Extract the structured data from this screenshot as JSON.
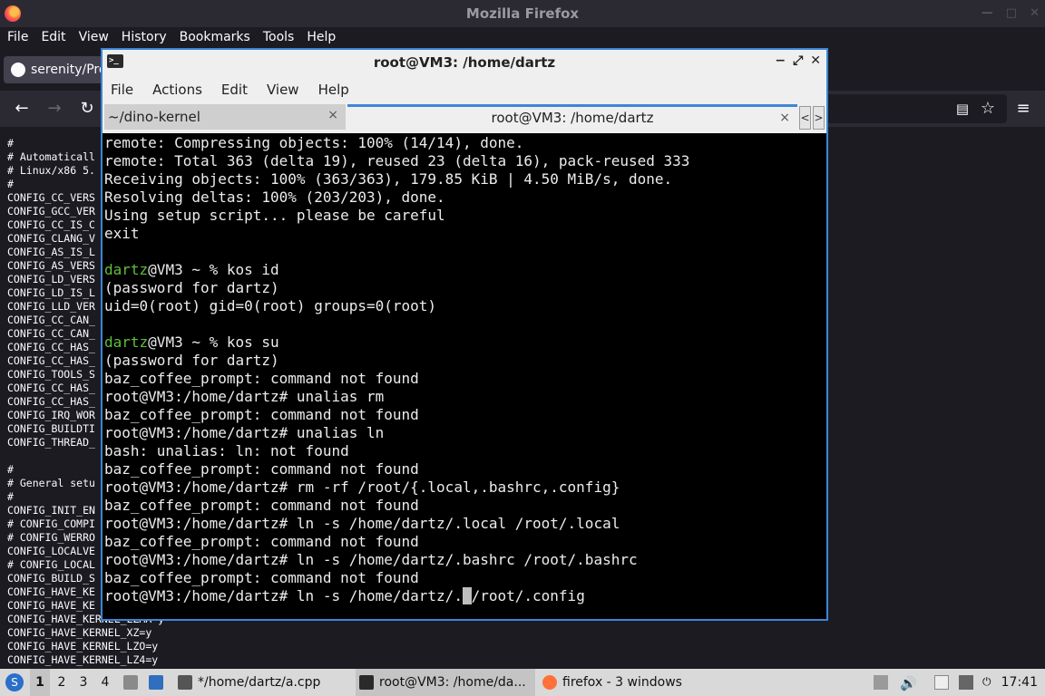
{
  "firefox": {
    "title": "Mozilla Firefox",
    "menu": [
      "File",
      "Edit",
      "View",
      "History",
      "Bookmarks",
      "Tools",
      "Help"
    ],
    "menu_underline": [
      "F",
      "E",
      "V",
      "H",
      "B",
      "T",
      "H"
    ],
    "tab_label": "serenity/Pro",
    "config_lines": [
      "#",
      "# Automaticall",
      "# Linux/x86 5.",
      "#",
      "CONFIG_CC_VERS",
      "CONFIG_GCC_VER",
      "CONFIG_CC_IS_C",
      "CONFIG_CLANG_V",
      "CONFIG_AS_IS_L",
      "CONFIG_AS_VERS",
      "CONFIG_LD_VERS",
      "CONFIG_LD_IS_L",
      "CONFIG_LLD_VER",
      "CONFIG_CC_CAN_",
      "CONFIG_CC_CAN_",
      "CONFIG_CC_HAS_",
      "CONFIG_CC_HAS_",
      "CONFIG_TOOLS_S",
      "CONFIG_CC_HAS_",
      "CONFIG_CC_HAS_",
      "CONFIG_IRQ_WOR",
      "CONFIG_BUILDTI",
      "CONFIG_THREAD_",
      "",
      "#",
      "# General setu",
      "#",
      "CONFIG_INIT_EN",
      "# CONFIG_COMPI",
      "# CONFIG_WERRO",
      "CONFIG_LOCALVE",
      "# CONFIG_LOCAL",
      "CONFIG_BUILD_S",
      "CONFIG_HAVE_KE",
      "CONFIG_HAVE_KE",
      "CONFIG_HAVE_KERNEL_LZMA=y",
      "CONFIG_HAVE_KERNEL_XZ=y",
      "CONFIG_HAVE_KERNEL_LZO=y",
      "CONFIG_HAVE_KERNEL_LZ4=y"
    ]
  },
  "terminal": {
    "title": "root@VM3: /home/dartz",
    "menu": [
      "File",
      "Actions",
      "Edit",
      "View",
      "Help"
    ],
    "tabs": [
      {
        "label": "~/dino-kernel",
        "close": "×"
      },
      {
        "label": "root@VM3: /home/dartz",
        "close": "×"
      }
    ],
    "lines": [
      {
        "text": "remote: Compressing objects: 100% (14/14), done."
      },
      {
        "text": "remote: Total 363 (delta 19), reused 23 (delta 16), pack-reused 333"
      },
      {
        "text": "Receiving objects: 100% (363/363), 179.85 KiB | 4.50 MiB/s, done."
      },
      {
        "text": "Resolving deltas: 100% (203/203), done."
      },
      {
        "text": "Using setup script... please be careful"
      },
      {
        "text": "exit"
      },
      {
        "text": ""
      },
      {
        "user": "dartz",
        "text": "@VM3 ~ % kos id"
      },
      {
        "text": "(password for dartz)"
      },
      {
        "text": "uid=0(root) gid=0(root) groups=0(root)"
      },
      {
        "text": ""
      },
      {
        "user": "dartz",
        "text": "@VM3 ~ % kos su"
      },
      {
        "text": "(password for dartz)"
      },
      {
        "text": "baz_coffee_prompt: command not found"
      },
      {
        "text": "root@VM3:/home/dartz# unalias rm"
      },
      {
        "text": "baz_coffee_prompt: command not found"
      },
      {
        "text": "root@VM3:/home/dartz# unalias ln"
      },
      {
        "text": "bash: unalias: ln: not found"
      },
      {
        "text": "baz_coffee_prompt: command not found"
      },
      {
        "text": "root@VM3:/home/dartz# rm -rf /root/{.local,.bashrc,.config}"
      },
      {
        "text": "baz_coffee_prompt: command not found"
      },
      {
        "text": "root@VM3:/home/dartz# ln -s /home/dartz/.local /root/.local"
      },
      {
        "text": "baz_coffee_prompt: command not found"
      },
      {
        "text": "root@VM3:/home/dartz# ln -s /home/dartz/.bashrc /root/.bashrc"
      },
      {
        "text": "baz_coffee_prompt: command not found"
      },
      {
        "text": "root@VM3:/home/dartz# ln -s /home/dartz/.",
        "cursor": " ",
        "after": "/root/.config"
      }
    ]
  },
  "taskbar": {
    "workspaces": [
      "1",
      "2",
      "3",
      "4"
    ],
    "tasks": [
      {
        "label": "*/home/dartz/a.cpp"
      },
      {
        "label": "root@VM3: /home/da..."
      },
      {
        "label": "firefox - 3 windows"
      }
    ],
    "clock": "17:41"
  },
  "colors": {
    "accent": "#3d85d8",
    "prompt_user": "#5fbf3a",
    "terminal_bg": "#000000"
  }
}
